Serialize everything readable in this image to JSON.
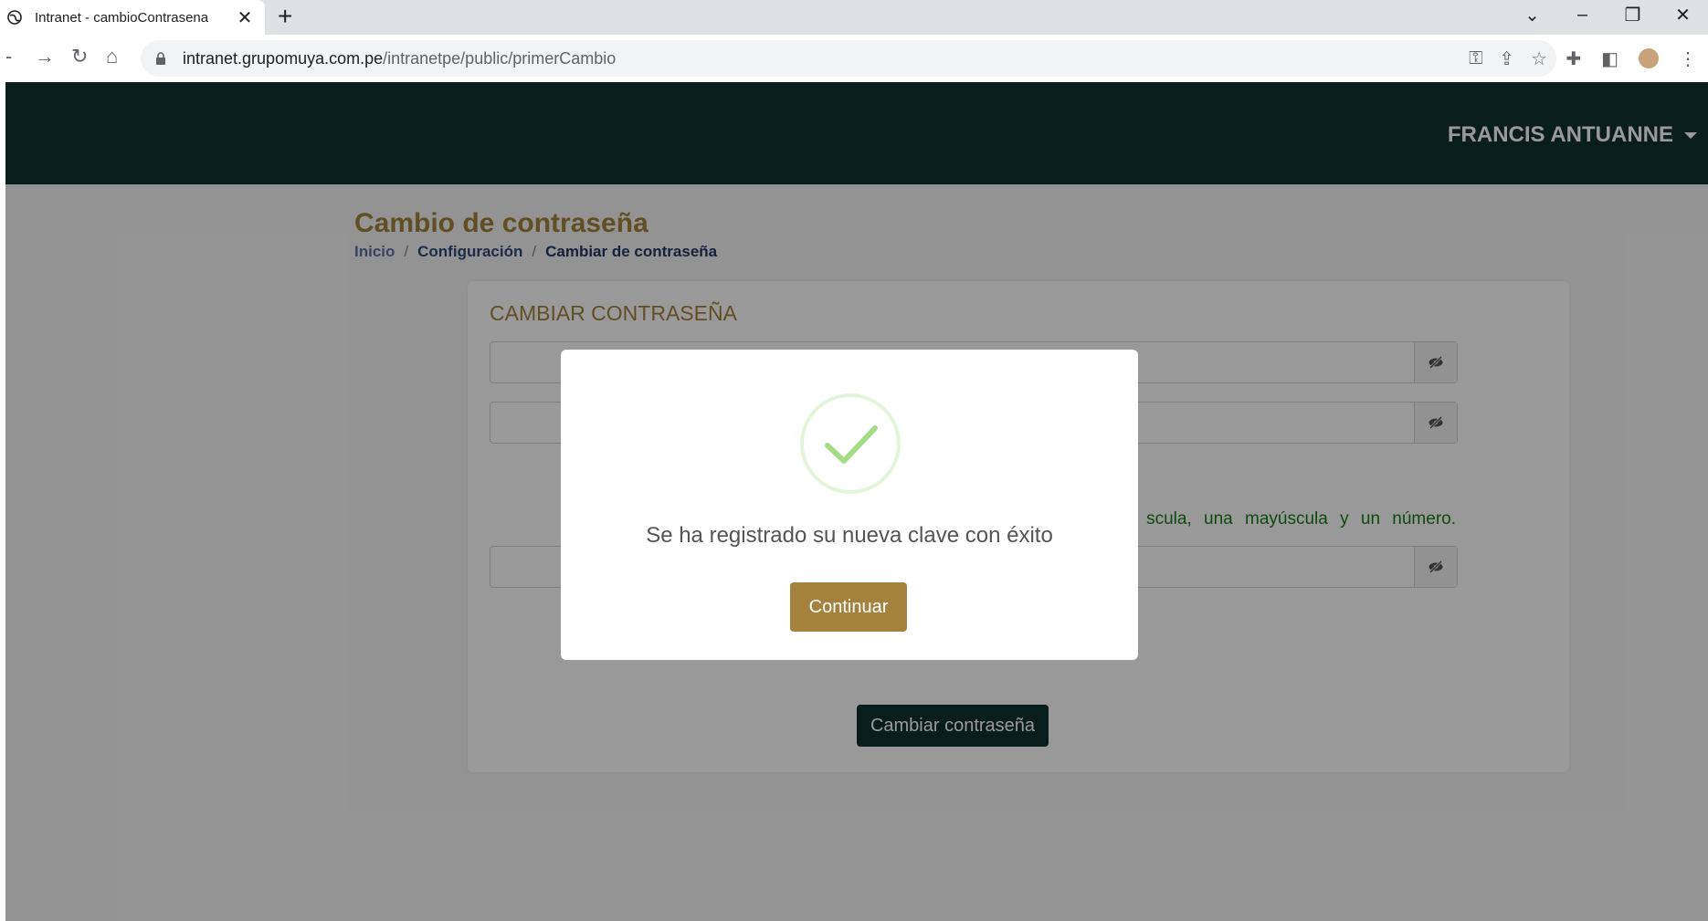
{
  "browser": {
    "tab_title": "Intranet - cambioContrasena",
    "new_tab": "+",
    "url_host": "intranet.grupomuya.com.pe",
    "url_path": "/intranetpe/public/primerCambio"
  },
  "header": {
    "user_name": "FRANCIS ANTUANNE"
  },
  "page": {
    "title": "Cambio de contraseña",
    "breadcrumb": [
      "Inicio",
      "Configuración",
      "Cambiar de contraseña"
    ],
    "breadcrumb_sep": "/"
  },
  "card": {
    "title": "CAMBIAR CONTRASEÑA",
    "hint_visible": "scula, una mayúscula y un número.",
    "submit_label": "Cambiar contraseña"
  },
  "modal": {
    "message": "Se ha registrado su nueva clave con éxito",
    "confirm_label": "Continuar"
  },
  "colors": {
    "header_bg": "#0e3130",
    "accent_gold": "#a4823e",
    "hint_green": "#1a7a1a",
    "success_green": "#a5dc86"
  }
}
